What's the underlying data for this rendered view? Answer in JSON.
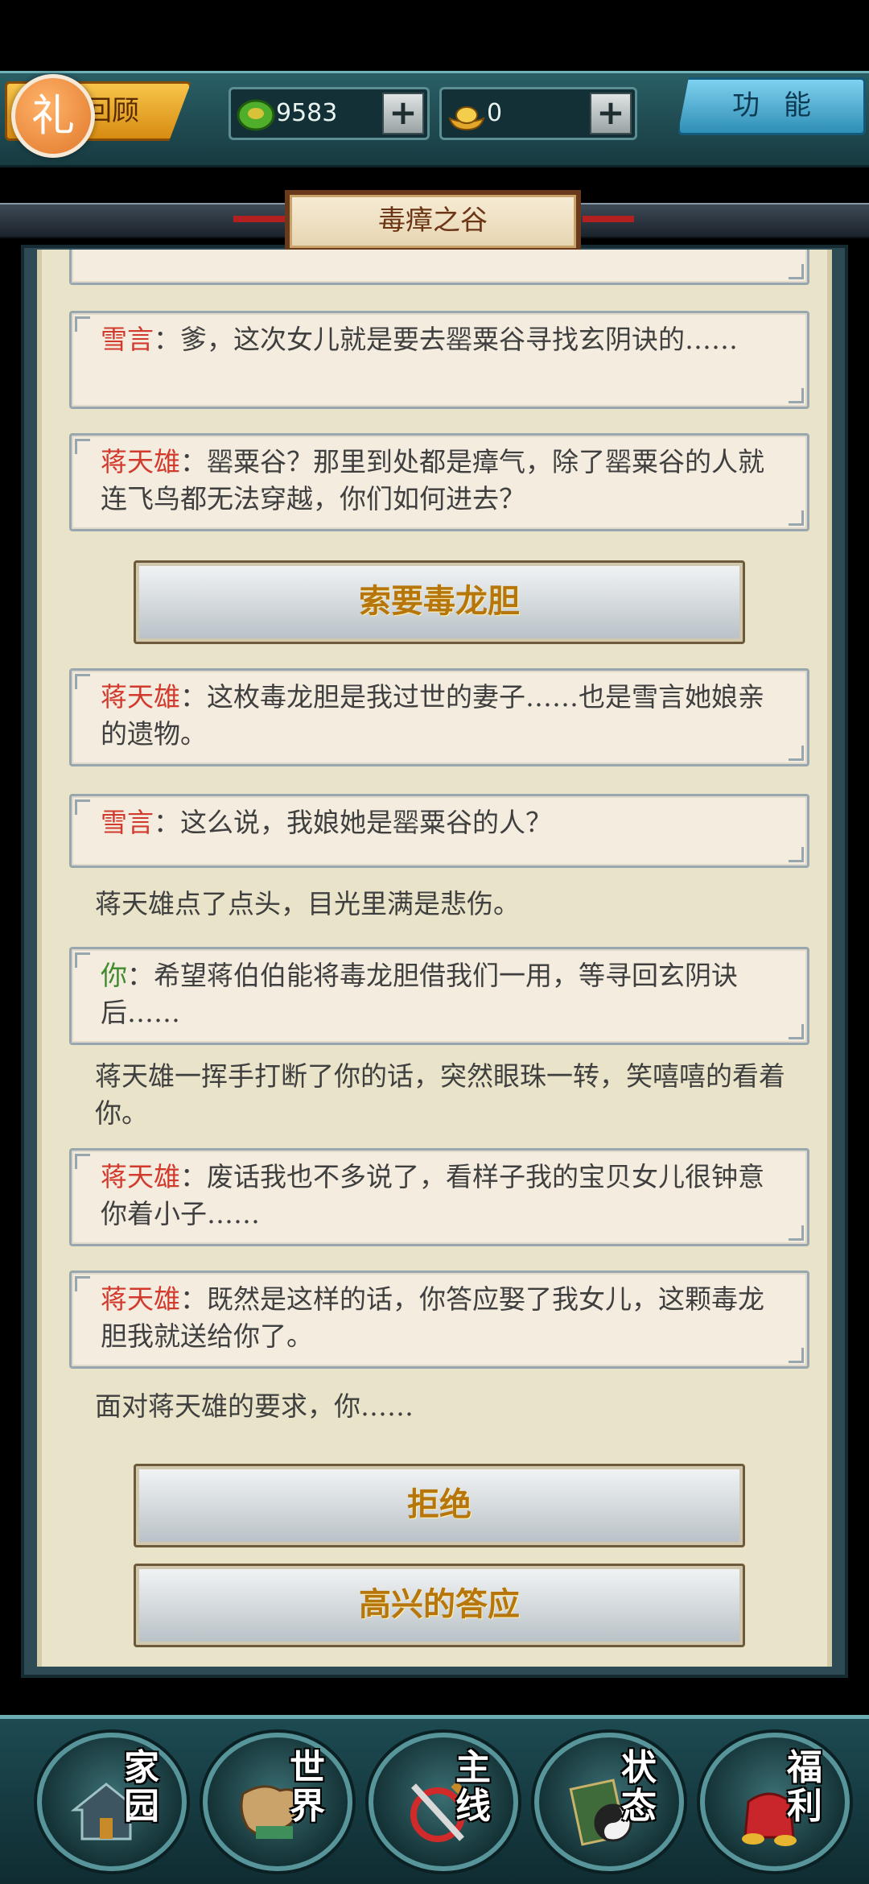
{
  "topbar": {
    "review_label": "回顾",
    "gift_badge": "礼",
    "jade": {
      "icon": "jade-coin-icon",
      "value": "9583",
      "plus": "+"
    },
    "gold": {
      "icon": "gold-ingot-icon",
      "value": "0",
      "plus": "+"
    },
    "function_label": "功能"
  },
  "chapter_title": "毒瘴之谷",
  "dialogue": [
    {
      "speaker": "雪言",
      "speaker_color": "red",
      "text": "：爹，这次女儿就是要去罂粟谷寻找玄阴诀的……"
    },
    {
      "speaker": "蒋天雄",
      "speaker_color": "red",
      "text": "：罂粟谷？那里到处都是瘴气，除了罂粟谷的人就连飞鸟都无法穿越，你们如何进去？"
    },
    {
      "speaker": "蒋天雄",
      "speaker_color": "red",
      "text": "：这枚毒龙胆是我过世的妻子……也是雪言她娘亲的遗物。"
    },
    {
      "speaker": "雪言",
      "speaker_color": "red",
      "text": "：这么说，我娘她是罂粟谷的人？"
    },
    {
      "speaker": "你",
      "speaker_color": "green",
      "text": "：希望蒋伯伯能将毒龙胆借我们一用，等寻回玄阴诀后……"
    },
    {
      "speaker": "蒋天雄",
      "speaker_color": "red",
      "text": "：废话我也不多说了，看样子我的宝贝女儿很钟意你着小子……"
    },
    {
      "speaker": "蒋天雄",
      "speaker_color": "red",
      "text": "：既然是这样的话，你答应娶了我女儿，这颗毒龙胆我就送给你了。"
    }
  ],
  "narration": [
    "蒋天雄点了点头，目光里满是悲伤。",
    "蒋天雄一挥手打断了你的话，突然眼珠一转，笑嘻嘻的看着你。",
    "面对蒋天雄的要求，你……"
  ],
  "choices": {
    "ask_gallbladder": "索要毒龙胆",
    "refuse": "拒绝",
    "accept_happily": "高兴的答应"
  },
  "bottom_nav": [
    {
      "label": "家园",
      "icon": "home-icon"
    },
    {
      "label": "世界",
      "icon": "world-map-icon"
    },
    {
      "label": "主线",
      "icon": "main-quest-icon"
    },
    {
      "label": "状态",
      "icon": "status-icon"
    },
    {
      "label": "福利",
      "icon": "welfare-icon"
    }
  ],
  "colors": {
    "speaker_red": "#d23a2e",
    "speaker_green": "#3f8a2c",
    "choice_text": "#b6760c"
  }
}
